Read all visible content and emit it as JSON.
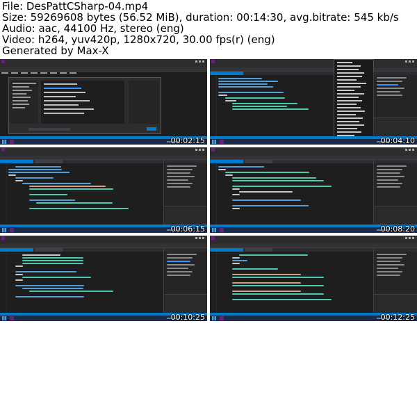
{
  "header": {
    "file": "File: DesPattCSharp-04.mp4",
    "size": "Size: 59269608 bytes (56.52 MiB), duration: 00:14:30, avg.bitrate: 545 kb/s",
    "audio": "Audio: aac, 44100 Hz, stereo (eng)",
    "video": "Video: h264, yuv420p, 1280x720, 30.00 fps(r) (eng)",
    "generated": "Generated by Max-X"
  },
  "thumbnails": [
    {
      "timestamp": "00:02:15",
      "view": "new-project-dialog"
    },
    {
      "timestamp": "00:04:10",
      "view": "context-menu"
    },
    {
      "timestamp": "00:06:15",
      "view": "code-editor"
    },
    {
      "timestamp": "00:08:20",
      "view": "code-editor"
    },
    {
      "timestamp": "00:10:25",
      "view": "code-editor"
    },
    {
      "timestamp": "00:12:25",
      "view": "code-editor"
    }
  ],
  "colors": {
    "background": "#ffffff",
    "ide_bg": "#1e1e1e",
    "accent": "#007acc",
    "taskbar": "#1b2a45",
    "vs_logo": "#68217a"
  },
  "icons": [
    "windows-start-icon",
    "visual-studio-icon"
  ]
}
